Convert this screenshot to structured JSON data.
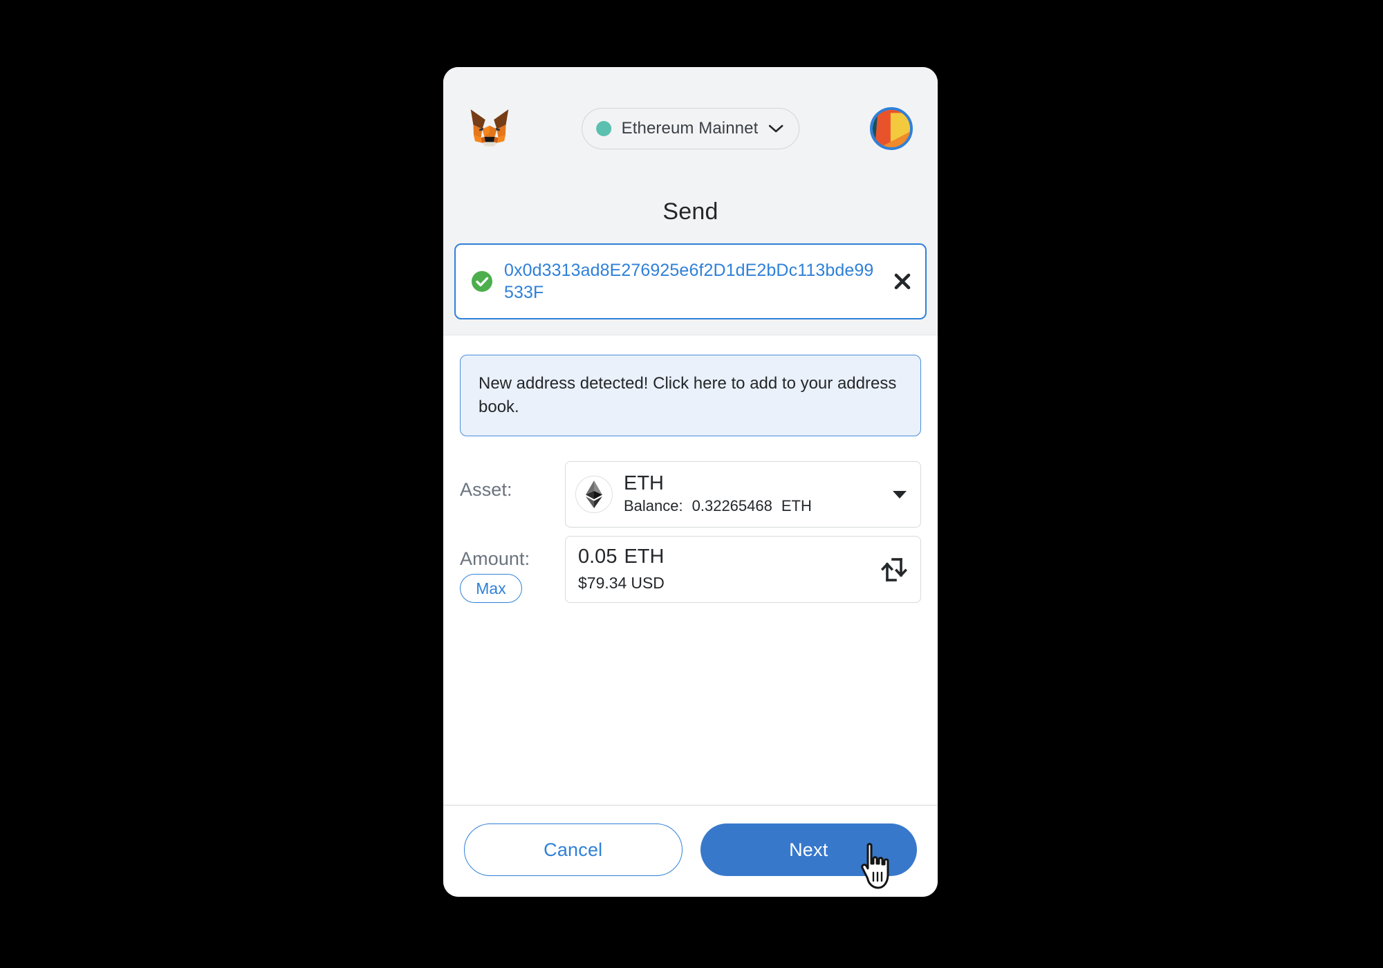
{
  "header": {
    "logo_icon": "metamask-fox-icon",
    "network": {
      "name": "Ethereum Mainnet",
      "dot_color": "#5bc0b0",
      "caret_icon": "chevron-down-icon"
    },
    "account_avatar_icon": "account-jazzicon-avatar",
    "avatar_ring_color": "#2f80d8"
  },
  "page_title": "Send",
  "recipient": {
    "valid_icon": "green-check-circle-icon",
    "address": "0x0d3313ad8E276925e6f2D1dE2bDc113bde99533F",
    "address_color": "#2f80d8",
    "clear_icon": "close-x-icon"
  },
  "notice": {
    "text": "New address detected! Click here to add to your address book.",
    "border_color": "#4b8ddb",
    "background_color": "#eaf1fa"
  },
  "asset": {
    "label": "Asset:",
    "token_icon": "ethereum-diamond-icon",
    "symbol": "ETH",
    "balance_label": "Balance:",
    "balance_value": "0.32265468",
    "balance_unit": "ETH",
    "dropdown_icon": "caret-down-solid-icon"
  },
  "amount": {
    "label": "Amount:",
    "max_label": "Max",
    "primary_value": "0.05",
    "primary_unit": "ETH",
    "secondary_value": "$79.34",
    "secondary_unit": "USD",
    "swap_icon": "swap-currency-icon"
  },
  "footer": {
    "cancel_label": "Cancel",
    "next_label": "Next",
    "next_color": "#3778cb"
  },
  "cursor": {
    "icon": "pointing-hand-cursor"
  }
}
